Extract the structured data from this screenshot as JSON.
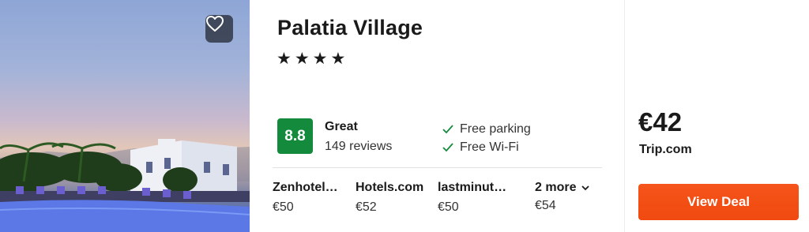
{
  "hotel": {
    "name": "Palatia Village",
    "stars_text": "★★★★",
    "star_count": 4
  },
  "rating": {
    "score": "8.8",
    "label": "Great",
    "reviews": "149 reviews",
    "badge_color": "#148a3c"
  },
  "amenities": [
    {
      "label": "Free parking",
      "icon": "check-icon"
    },
    {
      "label": "Free Wi-Fi",
      "icon": "check-icon"
    }
  ],
  "deals": [
    {
      "vendor": "Zenhotel…",
      "price": "€50"
    },
    {
      "vendor": "Hotels.com",
      "price": "€52"
    },
    {
      "vendor": "lastminut…",
      "price": "€50"
    }
  ],
  "more": {
    "label": "2 more",
    "price": "€54"
  },
  "best_offer": {
    "price": "€42",
    "provider": "Trip.com",
    "cta": "View Deal",
    "cta_color": "#f04a0f"
  }
}
